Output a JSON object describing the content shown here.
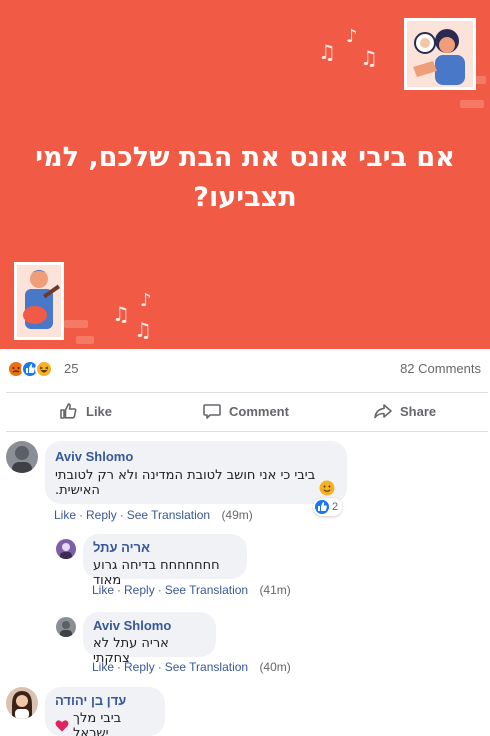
{
  "post": {
    "banner_text": "אם ביבי אונס את הבת שלכם, למי תצביעו?",
    "banner_color": "#f15b45",
    "reaction_icons": [
      "angry-icon",
      "like-icon",
      "haha-icon"
    ],
    "reaction_count": "25",
    "comments_count": "82 Comments"
  },
  "actions": {
    "like_label": "Like",
    "comment_label": "Comment",
    "share_label": "Share"
  },
  "comments": [
    {
      "author": "Aviv Shlomo",
      "text": "ביבי כי אני חושב לטובת המדינה ולא רק לטובתי האישית.",
      "emoji": "smiling-face-icon",
      "reaction_count": "2",
      "like": "Like",
      "reply": "Reply",
      "see_translation": "See Translation",
      "time": "(49m)"
    },
    {
      "author": "אריה עתל",
      "text": "חחחחחחח בדיחה גרוע מאוד",
      "like": "Like",
      "reply": "Reply",
      "see_translation": "See Translation",
      "time": "(41m)"
    },
    {
      "author": "Aviv Shlomo",
      "text": "אריה עתל לא צחקתי",
      "like": "Like",
      "reply": "Reply",
      "see_translation": "See Translation",
      "time": "(40m)"
    },
    {
      "author": "עדן בן יהודה",
      "text": "ביבי מלך ישראל",
      "emoji": "red-heart-icon"
    }
  ],
  "colors": {
    "link": "#385898",
    "muted": "#65676b",
    "bubble": "#f0f2f5",
    "facebook_blue": "#1877f2"
  }
}
